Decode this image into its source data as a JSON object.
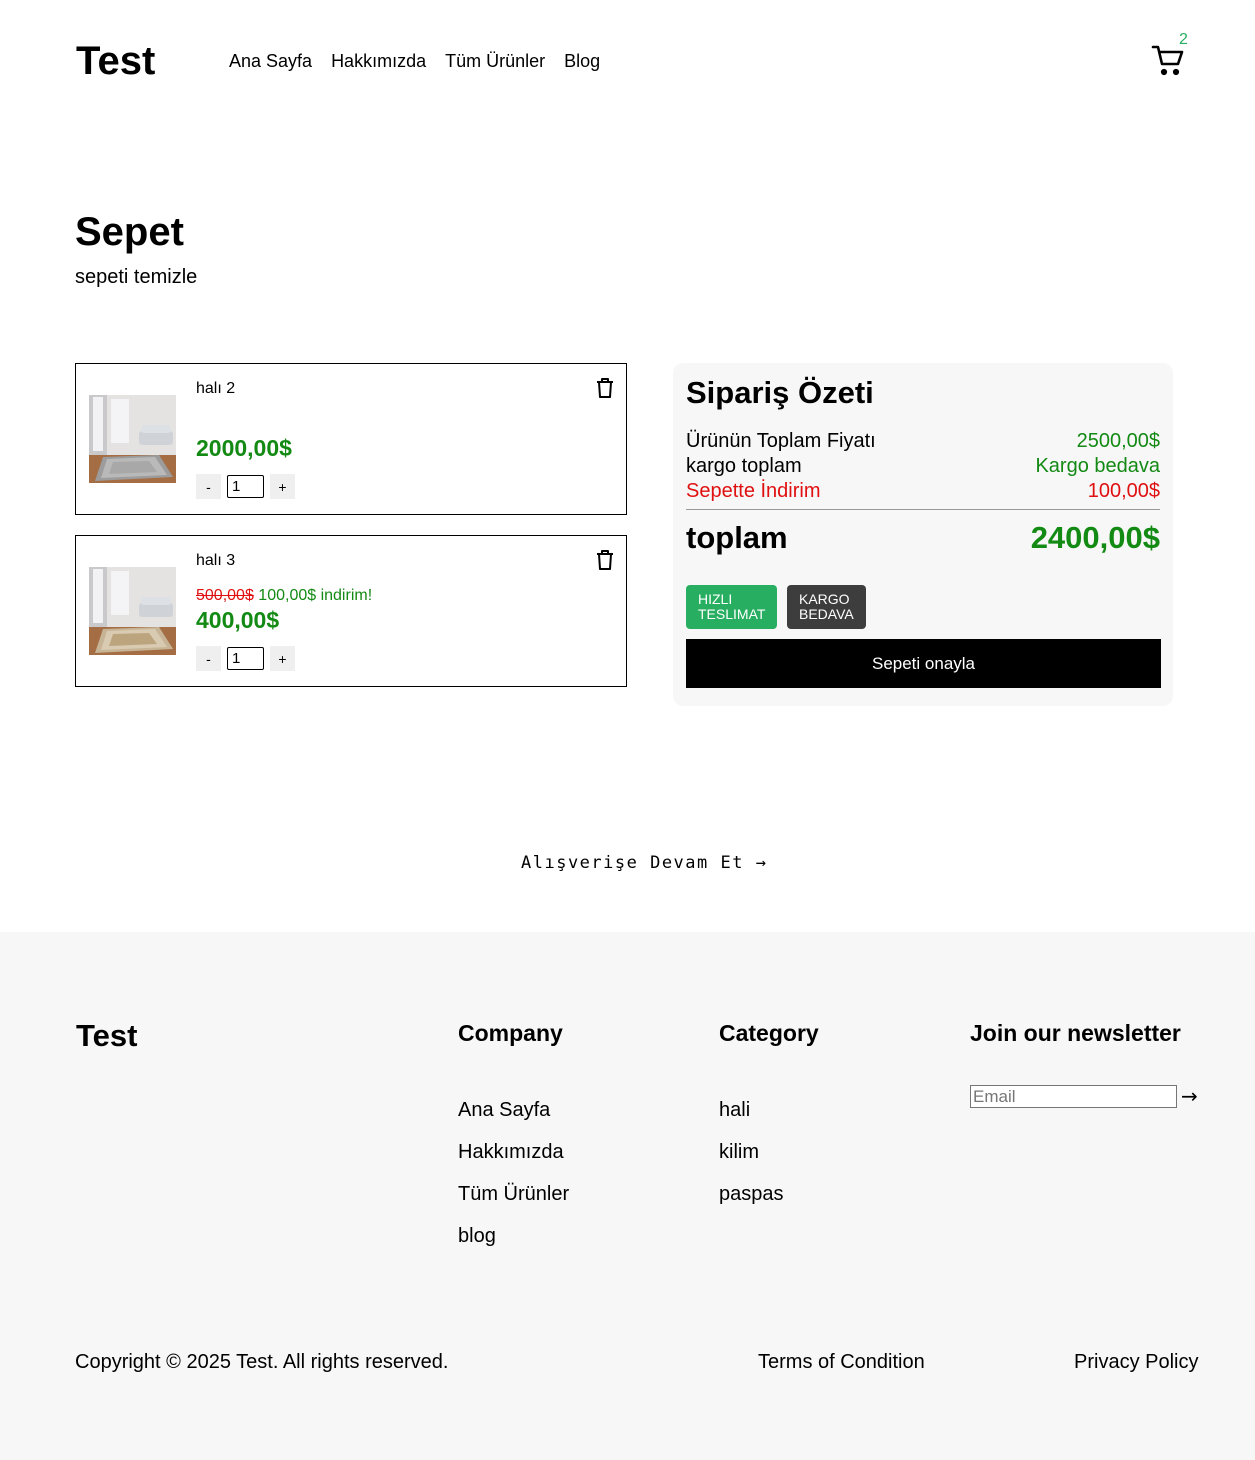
{
  "header": {
    "logo": "Test",
    "nav": [
      "Ana Sayfa",
      "Hakkımızda",
      "Tüm Ürünler",
      "Blog"
    ],
    "cart_count": "2",
    "cart_icon": "cart-icon"
  },
  "page": {
    "title": "Sepet",
    "clear_cart": "sepeti temizle"
  },
  "cart_items": [
    {
      "name": "halı 2",
      "price": "2000,00$",
      "quantity": "1",
      "minus": "-",
      "plus": "+"
    },
    {
      "name": "halı 3",
      "old_price": "500,00$",
      "discount_note": "100,00$ indirim!",
      "price": "400,00$",
      "quantity": "1",
      "minus": "-",
      "plus": "+"
    }
  ],
  "summary": {
    "title": "Sipariş Özeti",
    "rows": [
      {
        "label": "Ürünün Toplam Fiyatı",
        "value": "2500,00$"
      },
      {
        "label": "kargo toplam",
        "value": "Kargo bedava"
      },
      {
        "label": "Sepette İndirim",
        "value": "100,00$"
      }
    ],
    "total_label": "toplam",
    "total_value": "2400,00$",
    "badges": [
      "HIZLI TESLIMAT",
      "KARGO BEDAVA"
    ],
    "confirm": "Sepeti onayla"
  },
  "continue_shopping": "Alışverişe Devam Et →",
  "footer": {
    "logo": "Test",
    "company": {
      "heading": "Company",
      "links": [
        "Ana Sayfa",
        "Hakkımızda",
        "Tüm Ürünler",
        "blog"
      ]
    },
    "category": {
      "heading": "Category",
      "links": [
        "hali",
        "kilim",
        "paspas"
      ]
    },
    "newsletter": {
      "heading": "Join our newsletter",
      "placeholder": "Email",
      "submit": "→"
    },
    "copyright": "Copyright © 2025 Test. All rights reserved.",
    "terms": "Terms of Condition",
    "privacy": "Privacy Policy"
  },
  "colors": {
    "price_green": "#138a13",
    "discount_red": "#e01010",
    "badge_green": "#27ae60",
    "badge_dark": "#3d3d3d",
    "footer_bg": "#f7f7f8"
  }
}
